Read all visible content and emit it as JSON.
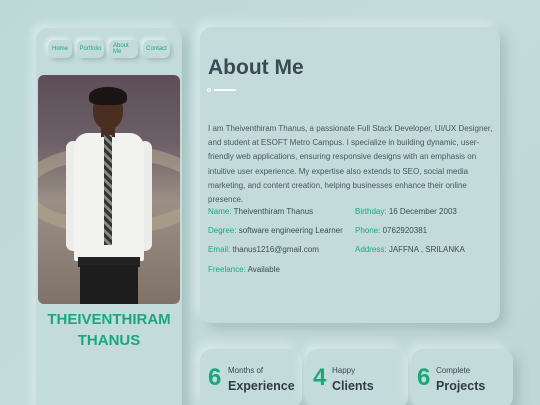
{
  "nav": {
    "items": [
      {
        "label": "Home"
      },
      {
        "label": "Portfolio"
      },
      {
        "label": "About Me"
      },
      {
        "label": "Contact"
      }
    ]
  },
  "profile": {
    "name_line1": "THEIVENTHIRAM",
    "name_line2": "THANUS"
  },
  "about": {
    "title": "About Me",
    "text": "I am Theiventhiram Thanus, a passionate Full Stack Developer, UI/UX Designer, and student at ESOFT Metro Campus. I specialize in building dynamic, user-friendly web applications, ensuring responsive designs with an emphasis on intuitive user experience. My expertise also extends to SEO, social media marketing, and content creation, helping businesses enhance their online presence.",
    "info": {
      "name_key": "Name:",
      "name_val": "Theiventhiram Thanus",
      "birthday_key": "Birthday:",
      "birthday_val": "16 December 2003",
      "degree_key": "Degree:",
      "degree_val": "software engineering Learner",
      "phone_key": "Phone:",
      "phone_val": "0762920381",
      "email_key": "Email:",
      "email_val": "thanus1216@gmail.com",
      "address_key": "Address:",
      "address_val": "JAFFNA , SRILANKA",
      "freelance_key": "Freelance:",
      "freelance_val": "Available"
    }
  },
  "stats": [
    {
      "number": "6",
      "small": "Months of",
      "big": "Experience"
    },
    {
      "number": "4",
      "small": "Happy",
      "big": "Clients"
    },
    {
      "number": "6",
      "small": "Complete",
      "big": "Projects"
    }
  ],
  "colors": {
    "accent": "#19a87a",
    "background": "#c3dcdb",
    "heading": "#3a4a55"
  }
}
